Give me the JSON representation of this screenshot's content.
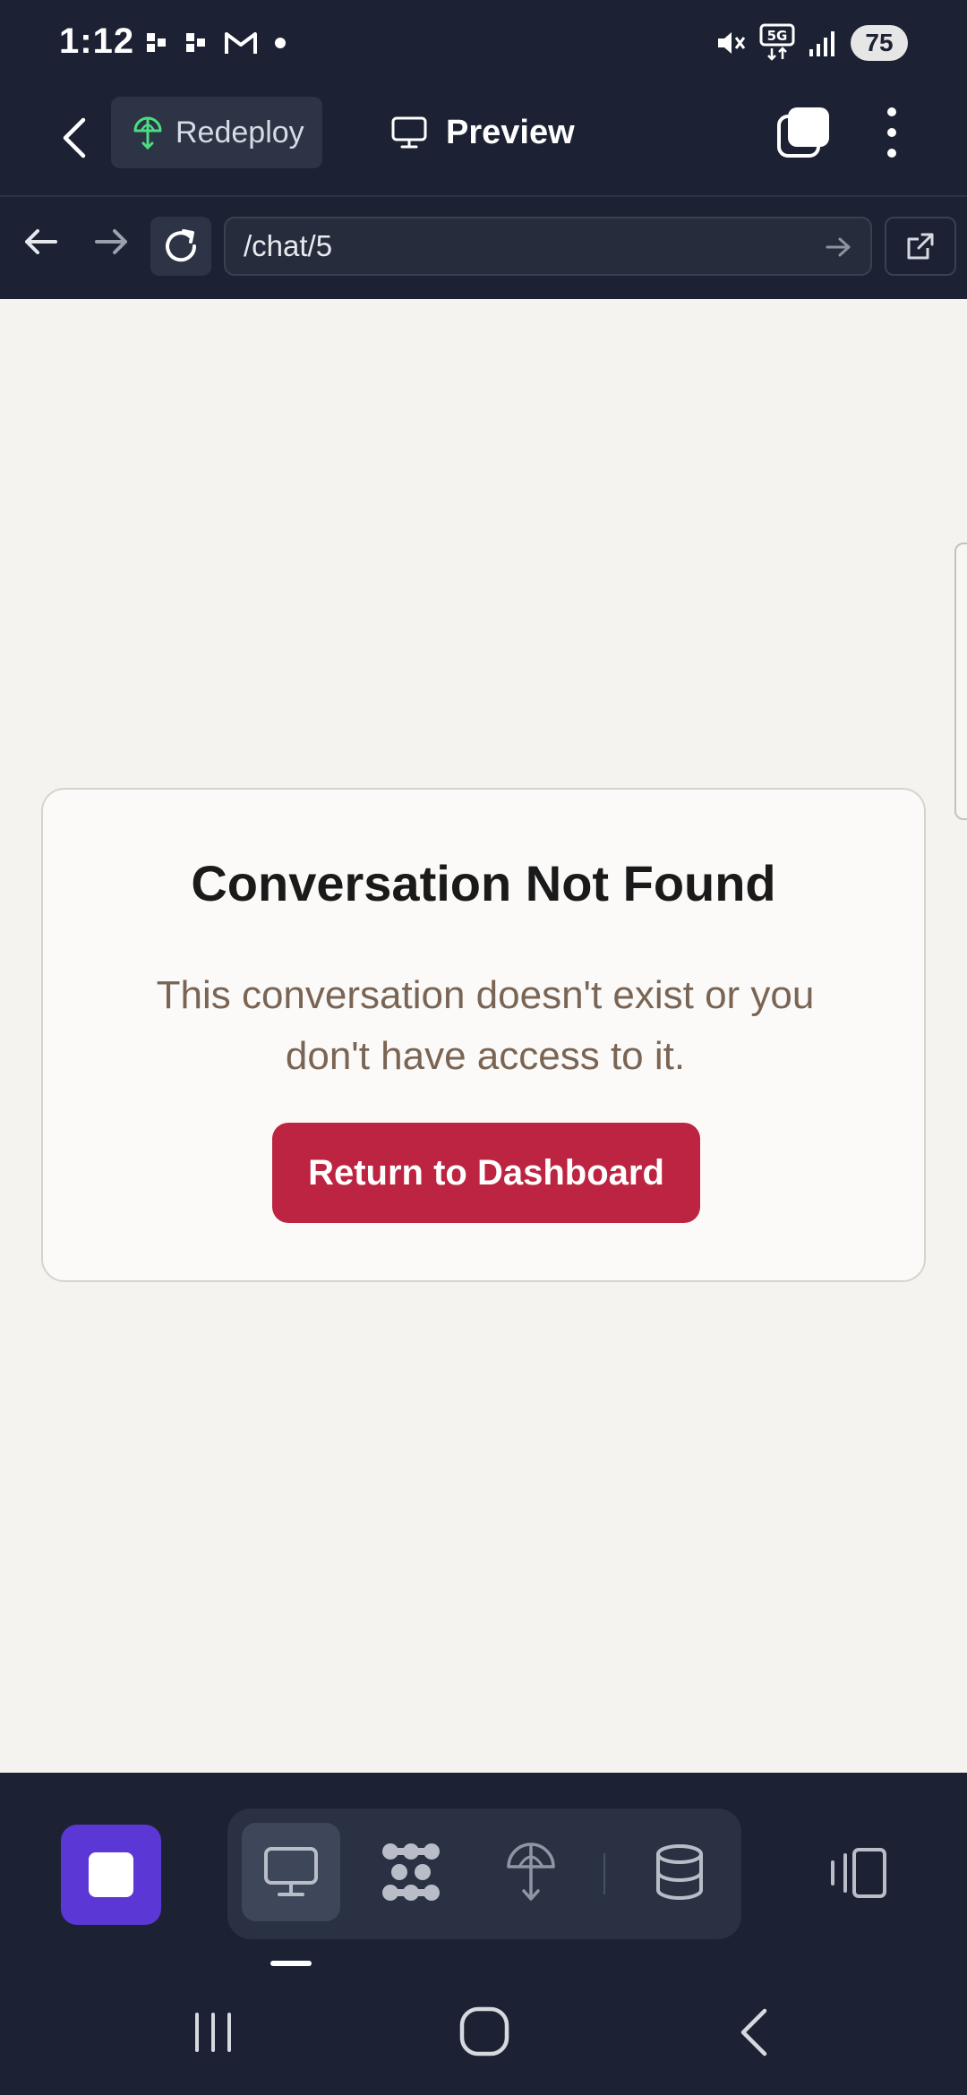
{
  "status_bar": {
    "time": "1:12",
    "left_icons": [
      "notification-dots-icon",
      "notification-dots-icon",
      "gmail-icon",
      "dot-icon"
    ],
    "right_icons": [
      "mute-icon",
      "5g-icon",
      "signal-icon"
    ],
    "network": "5G",
    "battery": "75"
  },
  "app_toolbar": {
    "redeploy_label": "Redeploy",
    "preview_label": "Preview",
    "accent_color": "#4ade80"
  },
  "browser_bar": {
    "url": "/chat/5"
  },
  "page": {
    "title": "Conversation Not Found",
    "message": "This conversation doesn't exist or you don't have access to it.",
    "button_label": "Return to Dashboard",
    "button_color": "#bc2441",
    "message_color": "#7a6555"
  },
  "dock": {
    "stop_color": "#5b38d5",
    "tools": [
      "desktop-icon",
      "agents-icon",
      "deploy-icon",
      "database-icon"
    ],
    "active_tool": "desktop-icon"
  }
}
